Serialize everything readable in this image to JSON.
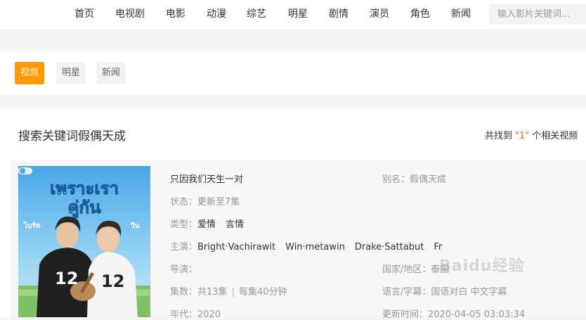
{
  "nav": {
    "items": [
      "首页",
      "电视剧",
      "电影",
      "动漫",
      "综艺",
      "明星",
      "剧情",
      "演员",
      "角色",
      "新闻"
    ],
    "search_placeholder": "输入影片关键词..."
  },
  "tabs": {
    "items": [
      {
        "label": "视频",
        "active": true
      },
      {
        "label": "明星",
        "active": false
      },
      {
        "label": "新闻",
        "active": false
      }
    ],
    "accent": "#ff9900"
  },
  "results": {
    "title": "搜索关键词假偶天成",
    "count_prefix": "共找到",
    "count": "\"1\"",
    "count_suffix": "个相关视频"
  },
  "item": {
    "poster": {
      "title_thai": "เพราะเรา",
      "title_thai_2": "คู่กัน",
      "jersey": "12",
      "name_left": "ไบร์ท",
      "name_right": "วิน"
    },
    "title": "只因我们天生一对",
    "alias_label": "别名：",
    "alias": "假偶天成",
    "status_label": "状态：",
    "status": "更新至7集",
    "genre_label": "类型：",
    "genres": [
      "爱情",
      "言情"
    ],
    "cast_label": "主演：",
    "cast": [
      "Bright·Vachirawit",
      "Win·metawin",
      "Drake·Sattabut",
      "Fr"
    ],
    "director_label": "导演：",
    "director": "",
    "country_label": "国家/地区：",
    "country": "泰国",
    "episodes_label": "集数：",
    "episodes": "共13集",
    "episode_length": "每集40分钟",
    "language_label": "语言/字幕：",
    "language": "国语对白 中文字幕",
    "year_label": "年代：",
    "year": "2020",
    "updated_label": "更新时间：",
    "updated": "2020-04-05 03:03:34"
  },
  "watermark": "Baidu经验"
}
